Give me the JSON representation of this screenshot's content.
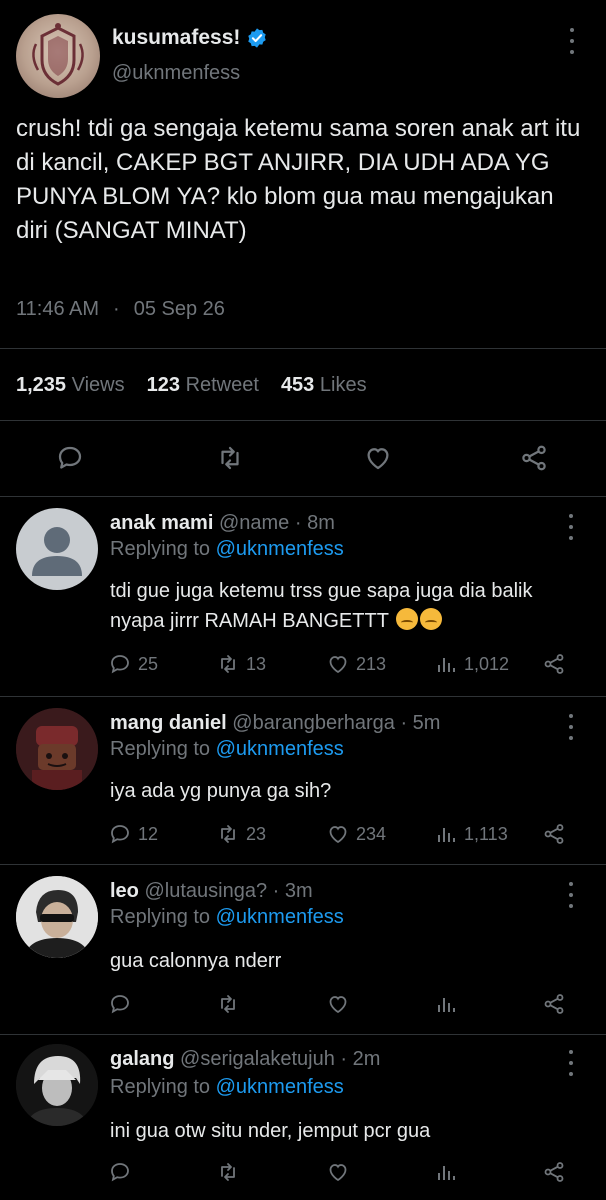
{
  "tweet": {
    "display_name": "kusumafess!",
    "handle": "@uknmenfess",
    "text": "crush! tdi ga sengaja ketemu sama soren anak art itu di kancil, CAKEP BGT ANJIRR, DIA UDH ADA YG PUNYA BLOM YA? klo blom gua mau mengajukan diri (SANGAT MINAT)",
    "time": "11:46 AM",
    "separator": "·",
    "date": "05 Sep 26",
    "views_count": "1,235",
    "views_label": "Views",
    "retweets_count": "123",
    "retweets_label": "Retweet",
    "likes_count": "453",
    "likes_label": "Likes"
  },
  "colors": {
    "background": "#000000",
    "text": "#e7e9ea",
    "muted": "#71767b",
    "link": "#1d9bf0",
    "divider": "#2f3336"
  },
  "replies": [
    {
      "name": "anak mami",
      "handle": "@name",
      "time": "· 8m",
      "replying_prefix": "Replying to",
      "replying_to": "@uknmenfess",
      "text": "tdi gue juga ketemu trss gue sapa juga dia balik nyapa jirrr RAMAH BANGETTT",
      "comments": "25",
      "retweets": "13",
      "likes": "213",
      "views": "1,012"
    },
    {
      "name": "mang daniel",
      "handle": "@barangberharga",
      "time": "· 5m",
      "replying_prefix": "Replying to",
      "replying_to": "@uknmenfess",
      "text": "iya ada yg punya ga sih?",
      "comments": "12",
      "retweets": "23",
      "likes": "234",
      "views": "1,113"
    },
    {
      "name": "leo",
      "handle": "@lutausinga?",
      "time": "· 3m",
      "replying_prefix": "Replying to",
      "replying_to": "@uknmenfess",
      "text": "gua calonnya nderr"
    },
    {
      "name": "galang",
      "handle": "@serigalaketujuh",
      "time": "· 2m",
      "replying_prefix": "Replying to",
      "replying_to": "@uknmenfess",
      "text": "ini gua otw situ nder, jemput pcr gua"
    }
  ]
}
